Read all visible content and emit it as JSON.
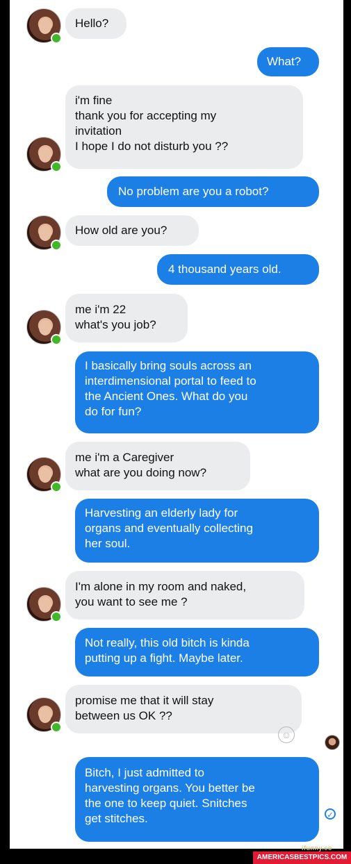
{
  "conversation": {
    "messages": [
      {
        "side": "incoming",
        "text": "Hello?"
      },
      {
        "side": "outgoing",
        "text": "What?"
      },
      {
        "side": "incoming",
        "text": "i'm fine\nthank you for accepting my\ninvitation\nI hope I do not disturb you ??"
      },
      {
        "side": "outgoing",
        "text": "No problem are you a robot?"
      },
      {
        "side": "incoming",
        "text": "How old are you?"
      },
      {
        "side": "outgoing",
        "text": "4 thousand years old."
      },
      {
        "side": "incoming",
        "text": "me i'm 22\nwhat's you job?"
      },
      {
        "side": "outgoing",
        "text": "I basically bring souls across an\ninterdimensional portal to feed to\nthe Ancient Ones. What do you\ndo for fun?"
      },
      {
        "side": "incoming",
        "text": "me i'm a Caregiver\nwhat are you doing now?"
      },
      {
        "side": "outgoing",
        "text": "Harvesting an elderly lady for\norgans and eventually collecting\nher soul."
      },
      {
        "side": "incoming",
        "text": "I'm alone in my room and naked,\nyou want to see me ?"
      },
      {
        "side": "outgoing",
        "text": "Not really, this old bitch is kinda\nputting up a fight. Maybe later."
      },
      {
        "side": "incoming",
        "text": "promise me that it will stay\nbetween us OK ??"
      },
      {
        "side": "outgoing",
        "text": "Bitch, I just admitted to\nharvesting organs. You better be\nthe one to keep quiet. Snitches\nget stitches."
      }
    ]
  },
  "icons": {
    "avatar": "contact-avatar",
    "online": "online-status-dot",
    "react": "add-reaction-icon",
    "react_glyph": "☺",
    "seen": "seen-avatar",
    "delivered": "delivered-check-icon",
    "delivered_glyph": "✓"
  },
  "watermarks": {
    "ifunny": "ifunny.co",
    "site": "AMERICASBESTPICS.COM"
  },
  "colors": {
    "outgoing_bubble": "#1b7fe6",
    "incoming_bubble": "#ebecee",
    "online": "#42b72a"
  }
}
